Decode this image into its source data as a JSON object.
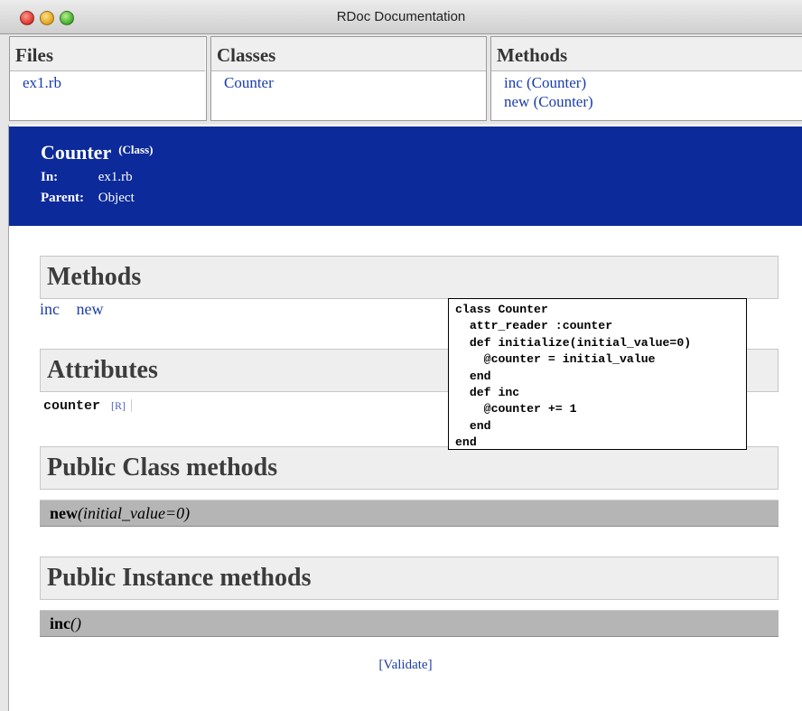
{
  "window": {
    "title": "RDoc Documentation"
  },
  "frames": {
    "files": {
      "title": "Files",
      "items": [
        "ex1.rb"
      ]
    },
    "classes": {
      "title": "Classes",
      "items": [
        "Counter"
      ]
    },
    "methods": {
      "title": "Methods",
      "items": [
        "inc (Counter)",
        "new (Counter)"
      ]
    }
  },
  "class_header": {
    "name": "Counter",
    "kind": "(Class)",
    "in_label": "In:",
    "in_value": "ex1.rb",
    "parent_label": "Parent:",
    "parent_value": "Object"
  },
  "sections": {
    "methods": {
      "title": "Methods",
      "links": [
        "inc",
        "new"
      ]
    },
    "attributes": {
      "title": "Attributes",
      "name": "counter",
      "mode": "[R]"
    },
    "public_class_methods": {
      "title": "Public Class methods",
      "method_name": "new",
      "method_args": "(initial_value=0)"
    },
    "public_instance_methods": {
      "title": "Public Instance methods",
      "method_name": "inc",
      "method_args": "()"
    }
  },
  "validate_link": "[Validate]",
  "source_code": "class Counter\n  attr_reader :counter\n  def initialize(initial_value=0)\n    @counter = initial_value\n  end\n  def inc\n    @counter += 1\n  end\nend",
  "colors": {
    "header_bg": "#0c2a9a",
    "link": "#1a3cac",
    "method_bar": "#b5b5b5"
  }
}
